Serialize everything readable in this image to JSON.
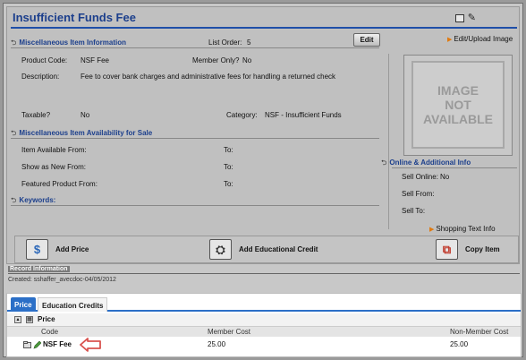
{
  "header": {
    "title": "Insufficient Funds Fee"
  },
  "info_section": {
    "heading": "Miscellaneous Item Information",
    "list_order_label": "List Order:",
    "list_order_value": "5",
    "edit_label": "Edit",
    "product_code_label": "Product Code:",
    "product_code_value": "NSF Fee",
    "member_only_label": "Member Only?",
    "member_only_value": "No",
    "description_label": "Description:",
    "description_value": "Fee to cover bank charges and administrative fees for handling a returned check",
    "taxable_label": "Taxable?",
    "taxable_value": "No",
    "category_label": "Category:",
    "category_value": "NSF - Insufficient Funds"
  },
  "image_panel": {
    "edit_upload_label": "Edit/Upload Image",
    "placeholder_text": "IMAGE\nNOT\nAVAILABLE"
  },
  "availability_section": {
    "heading": "Miscellaneous Item Availability for Sale",
    "rows": [
      {
        "label": "Item Available From:",
        "to_label": "To:"
      },
      {
        "label": "Show as New From:",
        "to_label": "To:"
      },
      {
        "label": "Featured Product From:",
        "to_label": "To:"
      }
    ]
  },
  "online_section": {
    "heading": "Online & Additional Info",
    "sell_online_label": "Sell Online:",
    "sell_online_value": "No",
    "sell_from_label": "Sell From:",
    "sell_to_label": "Sell To:",
    "shopping_text_label": "Shopping Text Info"
  },
  "keywords_section": {
    "heading": "Keywords:"
  },
  "actions": {
    "add_price": "Add Price",
    "add_educational_credit": "Add Educational Credit",
    "copy_item": "Copy Item"
  },
  "record_info": {
    "heading": "Record Information",
    "created": "Created: sshaffer_avecdoc-04/05/2012"
  },
  "tabs": {
    "items": [
      "Price",
      "Education Credits"
    ],
    "active_index": 0,
    "price_label": "Price",
    "columns": [
      "Code",
      "Member Cost",
      "Non-Member Cost"
    ],
    "rows": [
      {
        "code": "NSF Fee",
        "member_cost": "25.00",
        "non_member_cost": "25.00"
      }
    ]
  },
  "colors": {
    "title_blue": "#1c3f8c",
    "tab_blue": "#2b6fc7",
    "orange_accent": "#e07a10",
    "pointer_red": "#d9534f"
  }
}
